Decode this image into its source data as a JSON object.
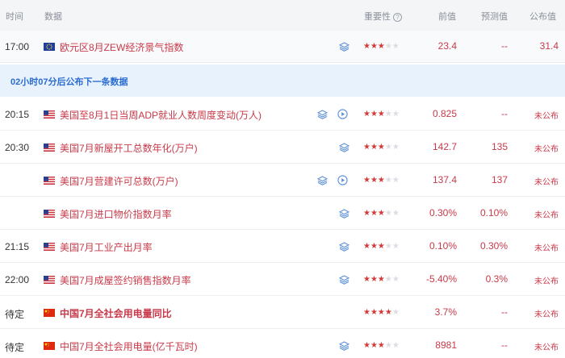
{
  "header": {
    "time": "时间",
    "data": "数据",
    "importance": "重要性",
    "help_icon": "?",
    "previous": "前值",
    "forecast": "预测值",
    "actual": "公布值"
  },
  "banner": {
    "text": "02小时07分后公布下一条数据"
  },
  "colors": {
    "accent": "#c83a4a",
    "banner_text": "#2a6bd1",
    "banner_bg": "#e8f2fd",
    "star_on": "#d43a3a",
    "star_off": "#dadde2"
  },
  "rows": [
    {
      "time": "17:00",
      "flag": "eu-flag-icon",
      "title": "欧元区8月ZEW经济景气指数",
      "importance": 3,
      "stars_on": "★★★",
      "stars_off": "★★",
      "previous": "23.4",
      "forecast": "--",
      "actual": "31.4"
    },
    {
      "time": "20:15",
      "flag": "us-flag-icon",
      "title": "美国至8月1日当周ADP就业人数周度变动(万人)",
      "importance": 3,
      "stars_on": "★★★",
      "stars_off": "★★",
      "previous": "0.825",
      "forecast": "--",
      "actual": "未公布"
    },
    {
      "time": "20:30",
      "flag": "us-flag-icon",
      "title": "美国7月新屋开工总数年化(万户)",
      "importance": 3,
      "stars_on": "★★★",
      "stars_off": "★★",
      "previous": "142.7",
      "forecast": "135",
      "actual": "未公布"
    },
    {
      "time": "",
      "flag": "us-flag-icon",
      "title": "美国7月营建许可总数(万户)",
      "importance": 3,
      "stars_on": "★★★",
      "stars_off": "★★",
      "previous": "137.4",
      "forecast": "137",
      "actual": "未公布"
    },
    {
      "time": "",
      "flag": "us-flag-icon",
      "title": "美国7月进口物价指数月率",
      "importance": 3,
      "stars_on": "★★★",
      "stars_off": "★★",
      "previous": "0.30%",
      "forecast": "0.10%",
      "actual": "未公布"
    },
    {
      "time": "21:15",
      "flag": "us-flag-icon",
      "title": "美国7月工业产出月率",
      "importance": 3,
      "stars_on": "★★★",
      "stars_off": "★★",
      "previous": "0.10%",
      "forecast": "0.30%",
      "actual": "未公布"
    },
    {
      "time": "22:00",
      "flag": "us-flag-icon",
      "title": "美国7月成屋签约销售指数月率",
      "importance": 3,
      "stars_on": "★★★",
      "stars_off": "★★",
      "previous": "-5.40%",
      "forecast": "0.3%",
      "actual": "未公布"
    },
    {
      "time": "待定",
      "flag": "cn-flag-icon",
      "title": "中国7月全社会用电量同比",
      "importance": 4,
      "stars_on": "★★★★",
      "stars_off": "★",
      "previous": "3.7%",
      "forecast": "--",
      "actual": "未公布"
    },
    {
      "time": "待定",
      "flag": "cn-flag-icon",
      "title": "中国7月全社会用电量(亿千瓦时)",
      "importance": 3,
      "stars_on": "★★★",
      "stars_off": "★★",
      "previous": "8981",
      "forecast": "--",
      "actual": "未公布"
    }
  ]
}
